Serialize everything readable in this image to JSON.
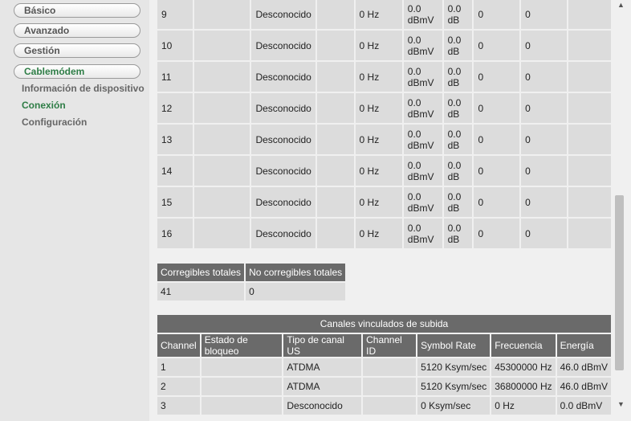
{
  "sidebar": {
    "items": [
      {
        "label": "Básico"
      },
      {
        "label": "Avanzado"
      },
      {
        "label": "Gestión"
      },
      {
        "label": "Cablemódem"
      }
    ],
    "subitems": [
      {
        "label": "Información de dispositivo"
      },
      {
        "label": "Conexión"
      },
      {
        "label": "Configuración"
      }
    ]
  },
  "downstream_rows": [
    {
      "id": "9",
      "status": "Desconocido",
      "freq": "0 Hz",
      "power_v": "0.0",
      "power_u": "dBmV",
      "snr_v": "0.0",
      "snr_u": "dB",
      "c1": "0",
      "c2": "0"
    },
    {
      "id": "10",
      "status": "Desconocido",
      "freq": "0 Hz",
      "power_v": "0.0",
      "power_u": "dBmV",
      "snr_v": "0.0",
      "snr_u": "dB",
      "c1": "0",
      "c2": "0"
    },
    {
      "id": "11",
      "status": "Desconocido",
      "freq": "0 Hz",
      "power_v": "0.0",
      "power_u": "dBmV",
      "snr_v": "0.0",
      "snr_u": "dB",
      "c1": "0",
      "c2": "0"
    },
    {
      "id": "12",
      "status": "Desconocido",
      "freq": "0 Hz",
      "power_v": "0.0",
      "power_u": "dBmV",
      "snr_v": "0.0",
      "snr_u": "dB",
      "c1": "0",
      "c2": "0"
    },
    {
      "id": "13",
      "status": "Desconocido",
      "freq": "0 Hz",
      "power_v": "0.0",
      "power_u": "dBmV",
      "snr_v": "0.0",
      "snr_u": "dB",
      "c1": "0",
      "c2": "0"
    },
    {
      "id": "14",
      "status": "Desconocido",
      "freq": "0 Hz",
      "power_v": "0.0",
      "power_u": "dBmV",
      "snr_v": "0.0",
      "snr_u": "dB",
      "c1": "0",
      "c2": "0"
    },
    {
      "id": "15",
      "status": "Desconocido",
      "freq": "0 Hz",
      "power_v": "0.0",
      "power_u": "dBmV",
      "snr_v": "0.0",
      "snr_u": "dB",
      "c1": "0",
      "c2": "0"
    },
    {
      "id": "16",
      "status": "Desconocido",
      "freq": "0 Hz",
      "power_v": "0.0",
      "power_u": "dBmV",
      "snr_v": "0.0",
      "snr_u": "dB",
      "c1": "0",
      "c2": "0"
    }
  ],
  "totals": {
    "headers": [
      "Corregibles totales",
      "No corregibles totales"
    ],
    "values": [
      "41",
      "0"
    ]
  },
  "upstream": {
    "caption": "Canales vinculados de subida",
    "headers": [
      "Channel",
      "Estado de bloqueo",
      "Tipo de canal US",
      "Channel ID",
      "Symbol Rate",
      "Frecuencia",
      "Energía"
    ],
    "rows": [
      [
        "1",
        "",
        "ATDMA",
        "",
        "5120 Ksym/sec",
        "45300000 Hz",
        "46.0 dBmV"
      ],
      [
        "2",
        "",
        "ATDMA",
        "",
        "5120 Ksym/sec",
        "36800000 Hz",
        "46.0 dBmV"
      ],
      [
        "3",
        "",
        "Desconocido",
        "",
        "0 Ksym/sec",
        "0 Hz",
        "0.0 dBmV"
      ]
    ]
  },
  "scrollbar": {
    "up": "▲",
    "down": "▼"
  }
}
